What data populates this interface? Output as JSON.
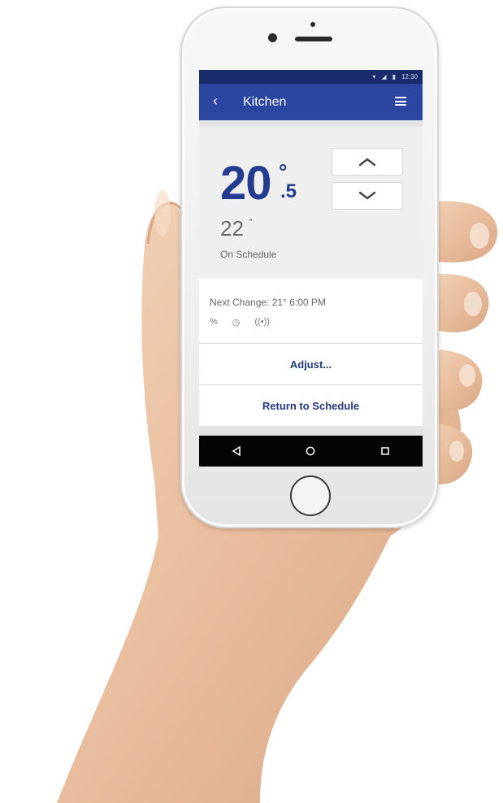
{
  "status_bar": {
    "time": "12:30",
    "wifi_icon": "wifi-icon",
    "signal_icon": "signal-icon",
    "battery_icon": "battery-icon"
  },
  "app_bar": {
    "title": "Kitchen",
    "back_icon": "back-icon",
    "menu_icon": "menu-icon"
  },
  "thermostat": {
    "setpoint_whole": "20",
    "setpoint_degree": "°",
    "setpoint_decimal": ".5",
    "current_temp": "22",
    "current_degree": "°",
    "status": "On Schedule"
  },
  "next_change": "Next Change: 21°  6:00 PM",
  "mode_icons": [
    "humidity-icon",
    "clock-icon",
    "wireless-icon"
  ],
  "actions": {
    "adjust": "Adjust...",
    "return": "Return to Schedule"
  },
  "nav_bar": [
    "back-triangle-icon",
    "home-circle-icon",
    "recents-square-icon"
  ],
  "colors": {
    "status_bar": "#1a2b6c",
    "app_bar": "#2a46a0",
    "accent_text": "#233c8f"
  }
}
